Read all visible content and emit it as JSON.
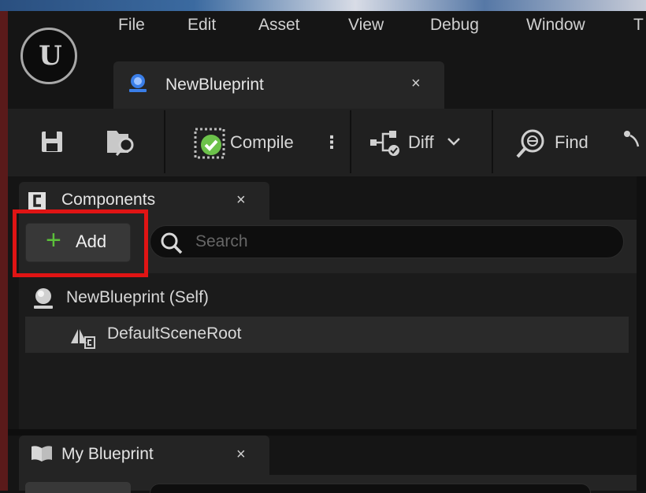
{
  "menu": [
    "File",
    "Edit",
    "Asset",
    "View",
    "Debug",
    "Window",
    "T"
  ],
  "logo": {
    "icon": "unreal-logo-icon",
    "text": "U"
  },
  "document_tab": {
    "label": "NewBlueprint",
    "icon": "blueprint-icon",
    "close": "×"
  },
  "toolbar": {
    "save_icon": "save-icon",
    "browse_icon": "browse-icon",
    "compile_label": "Compile",
    "compile_options": "⋮",
    "diff_label": "Diff",
    "find_label": "Find"
  },
  "components_panel": {
    "tab_label": "Components",
    "tab_close": "×",
    "add_plus": "+",
    "add_label": "Add",
    "search_placeholder": "Search",
    "tree": [
      {
        "label": "NewBlueprint (Self)",
        "icon": "actor-sphere-icon"
      },
      {
        "label": "DefaultSceneRoot",
        "icon": "scene-root-icon"
      }
    ]
  },
  "my_blueprint_panel": {
    "tab_label": "My Blueprint",
    "tab_close": "×",
    "icon": "book-icon"
  },
  "colors": {
    "highlight": "#e01414",
    "add_plus": "#5bc03a",
    "compile_check": "#6cc24a"
  }
}
